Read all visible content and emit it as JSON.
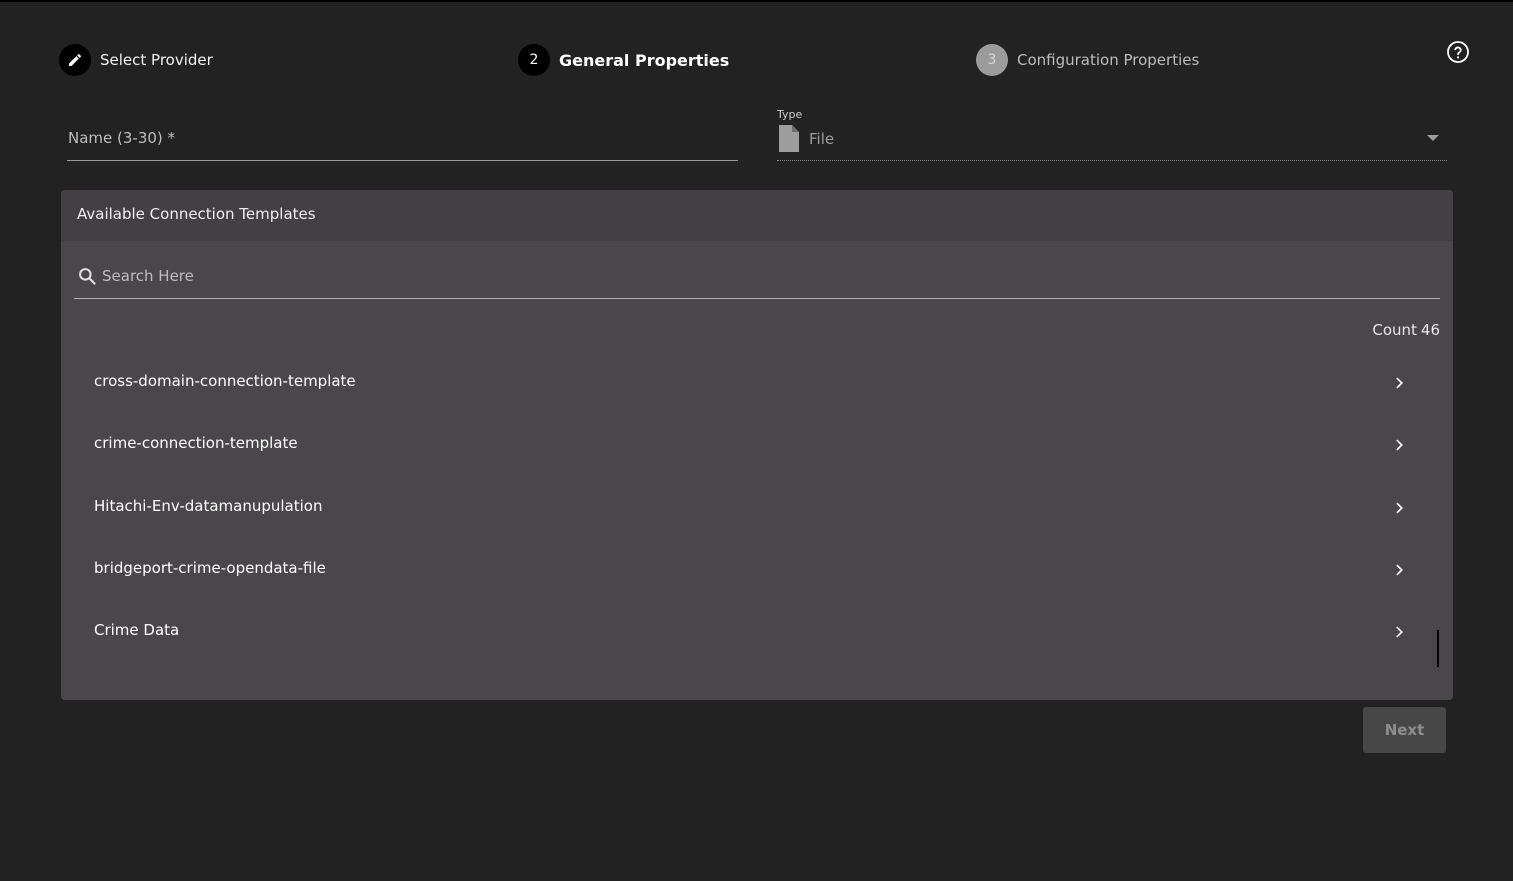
{
  "stepper": {
    "steps": [
      {
        "number": "",
        "label": "Select Provider",
        "state": "completed"
      },
      {
        "number": "2",
        "label": "General Properties",
        "state": "active"
      },
      {
        "number": "3",
        "label": "Configuration Properties",
        "state": "pending"
      }
    ]
  },
  "help": {
    "icon": "help-circle-icon"
  },
  "form": {
    "name_placeholder": "Name (3-30) *",
    "name_value": "",
    "type_label": "Type",
    "type_value": "File",
    "type_icon": "file-icon"
  },
  "templates": {
    "title": "Available Connection Templates",
    "search_placeholder": "Search Here",
    "count_label": "Count",
    "count_value": "46",
    "items": [
      {
        "label": "cross-domain-connection-template"
      },
      {
        "label": "crime-connection-template"
      },
      {
        "label": "Hitachi-Env-datamanupulation"
      },
      {
        "label": "bridgeport-crime-opendata-file"
      },
      {
        "label": "Crime Data"
      }
    ]
  },
  "footer": {
    "next_label": "Next",
    "next_enabled": false
  },
  "colors": {
    "background": "#222222",
    "panel": "#4a474b",
    "panel_header": "#433f44",
    "active_step": "#000000",
    "pending_step": "#9b9b9b"
  }
}
